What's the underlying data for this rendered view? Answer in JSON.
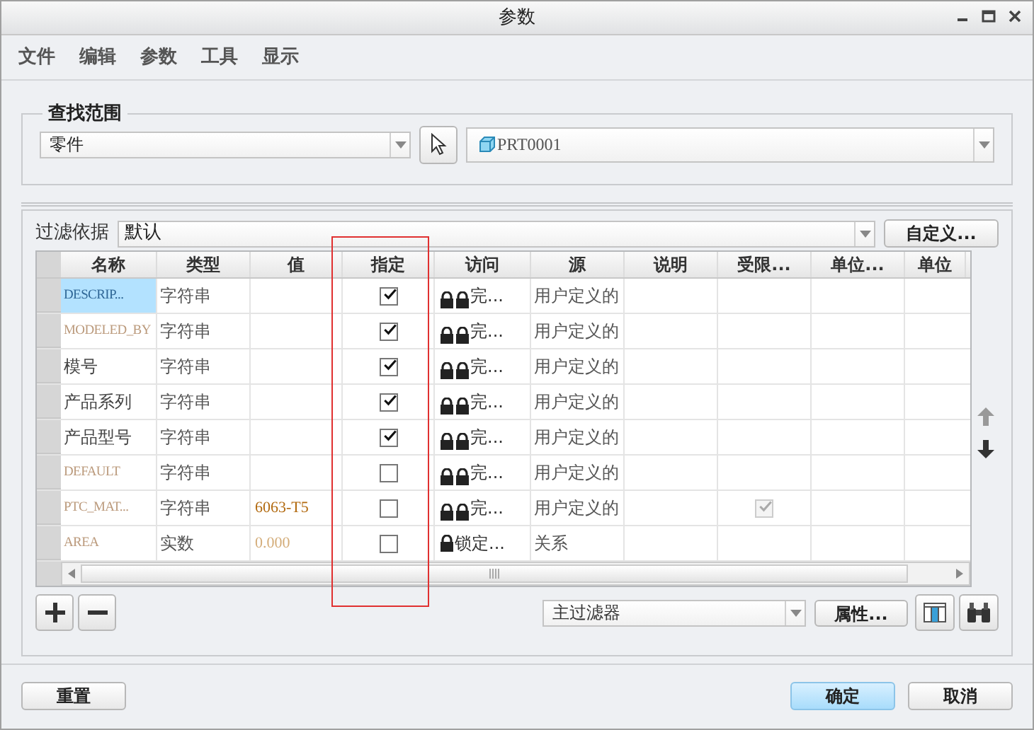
{
  "window": {
    "title": "参数"
  },
  "menu": [
    {
      "label": "文件"
    },
    {
      "label": "编辑"
    },
    {
      "label": "参数"
    },
    {
      "label": "工具"
    },
    {
      "label": "显示"
    }
  ],
  "search_scope": {
    "title": "查找范围",
    "type_select": "零件",
    "model_select": "PRT0001"
  },
  "filter": {
    "label": "过滤依据",
    "value": "默认",
    "customize_button": "自定义..."
  },
  "table": {
    "columns": [
      "名称",
      "类型",
      "值",
      "指定",
      "访问",
      "源",
      "说明",
      "受限...",
      "单位...",
      "单位"
    ],
    "rows": [
      {
        "name": "DESCRIP...",
        "kind": "system",
        "selected": true,
        "type": "字符串",
        "designated": true,
        "access": {
          "text": "完...",
          "kind": "full"
        },
        "source": "用户定义的",
        "restricted": false
      },
      {
        "name": "MODELED_BY",
        "kind": "system",
        "selected": false,
        "type": "字符串",
        "designated": true,
        "access": {
          "text": "完...",
          "kind": "full"
        },
        "source": "用户定义的",
        "restricted": false
      },
      {
        "name": "模号",
        "kind": "user",
        "selected": false,
        "type": "字符串",
        "designated": true,
        "access": {
          "text": "完...",
          "kind": "full"
        },
        "source": "用户定义的",
        "restricted": false
      },
      {
        "name": "产品系列",
        "kind": "user",
        "selected": false,
        "type": "字符串",
        "designated": true,
        "access": {
          "text": "完...",
          "kind": "full"
        },
        "source": "用户定义的",
        "restricted": false
      },
      {
        "name": "产品型号",
        "kind": "user",
        "selected": false,
        "type": "字符串",
        "designated": true,
        "access": {
          "text": "完...",
          "kind": "full"
        },
        "source": "用户定义的",
        "restricted": false
      },
      {
        "name": "DEFAULT",
        "kind": "system",
        "selected": false,
        "type": "字符串",
        "designated": false,
        "access": {
          "text": "完...",
          "kind": "full"
        },
        "source": "用户定义的",
        "restricted": false
      },
      {
        "name": "PTC_MAT...",
        "kind": "system",
        "selected": false,
        "type": "字符串",
        "value": {
          "text": "6063-T5",
          "kind": "dark"
        },
        "designated": false,
        "access": {
          "text": "完...",
          "kind": "full"
        },
        "source": "用户定义的",
        "restricted": true
      },
      {
        "name": "AREA",
        "kind": "system",
        "selected": false,
        "type": "实数",
        "value": {
          "text": "0.000",
          "kind": "light"
        },
        "designated": false,
        "access": {
          "text": "锁定...",
          "kind": "locked"
        },
        "source": "关系",
        "restricted": false
      }
    ]
  },
  "bottom_toolbar": {
    "filter_select": "主过滤器",
    "properties_button": "属性..."
  },
  "footer": {
    "reset_button": "重置",
    "ok_button": "确定",
    "cancel_button": "取消"
  }
}
